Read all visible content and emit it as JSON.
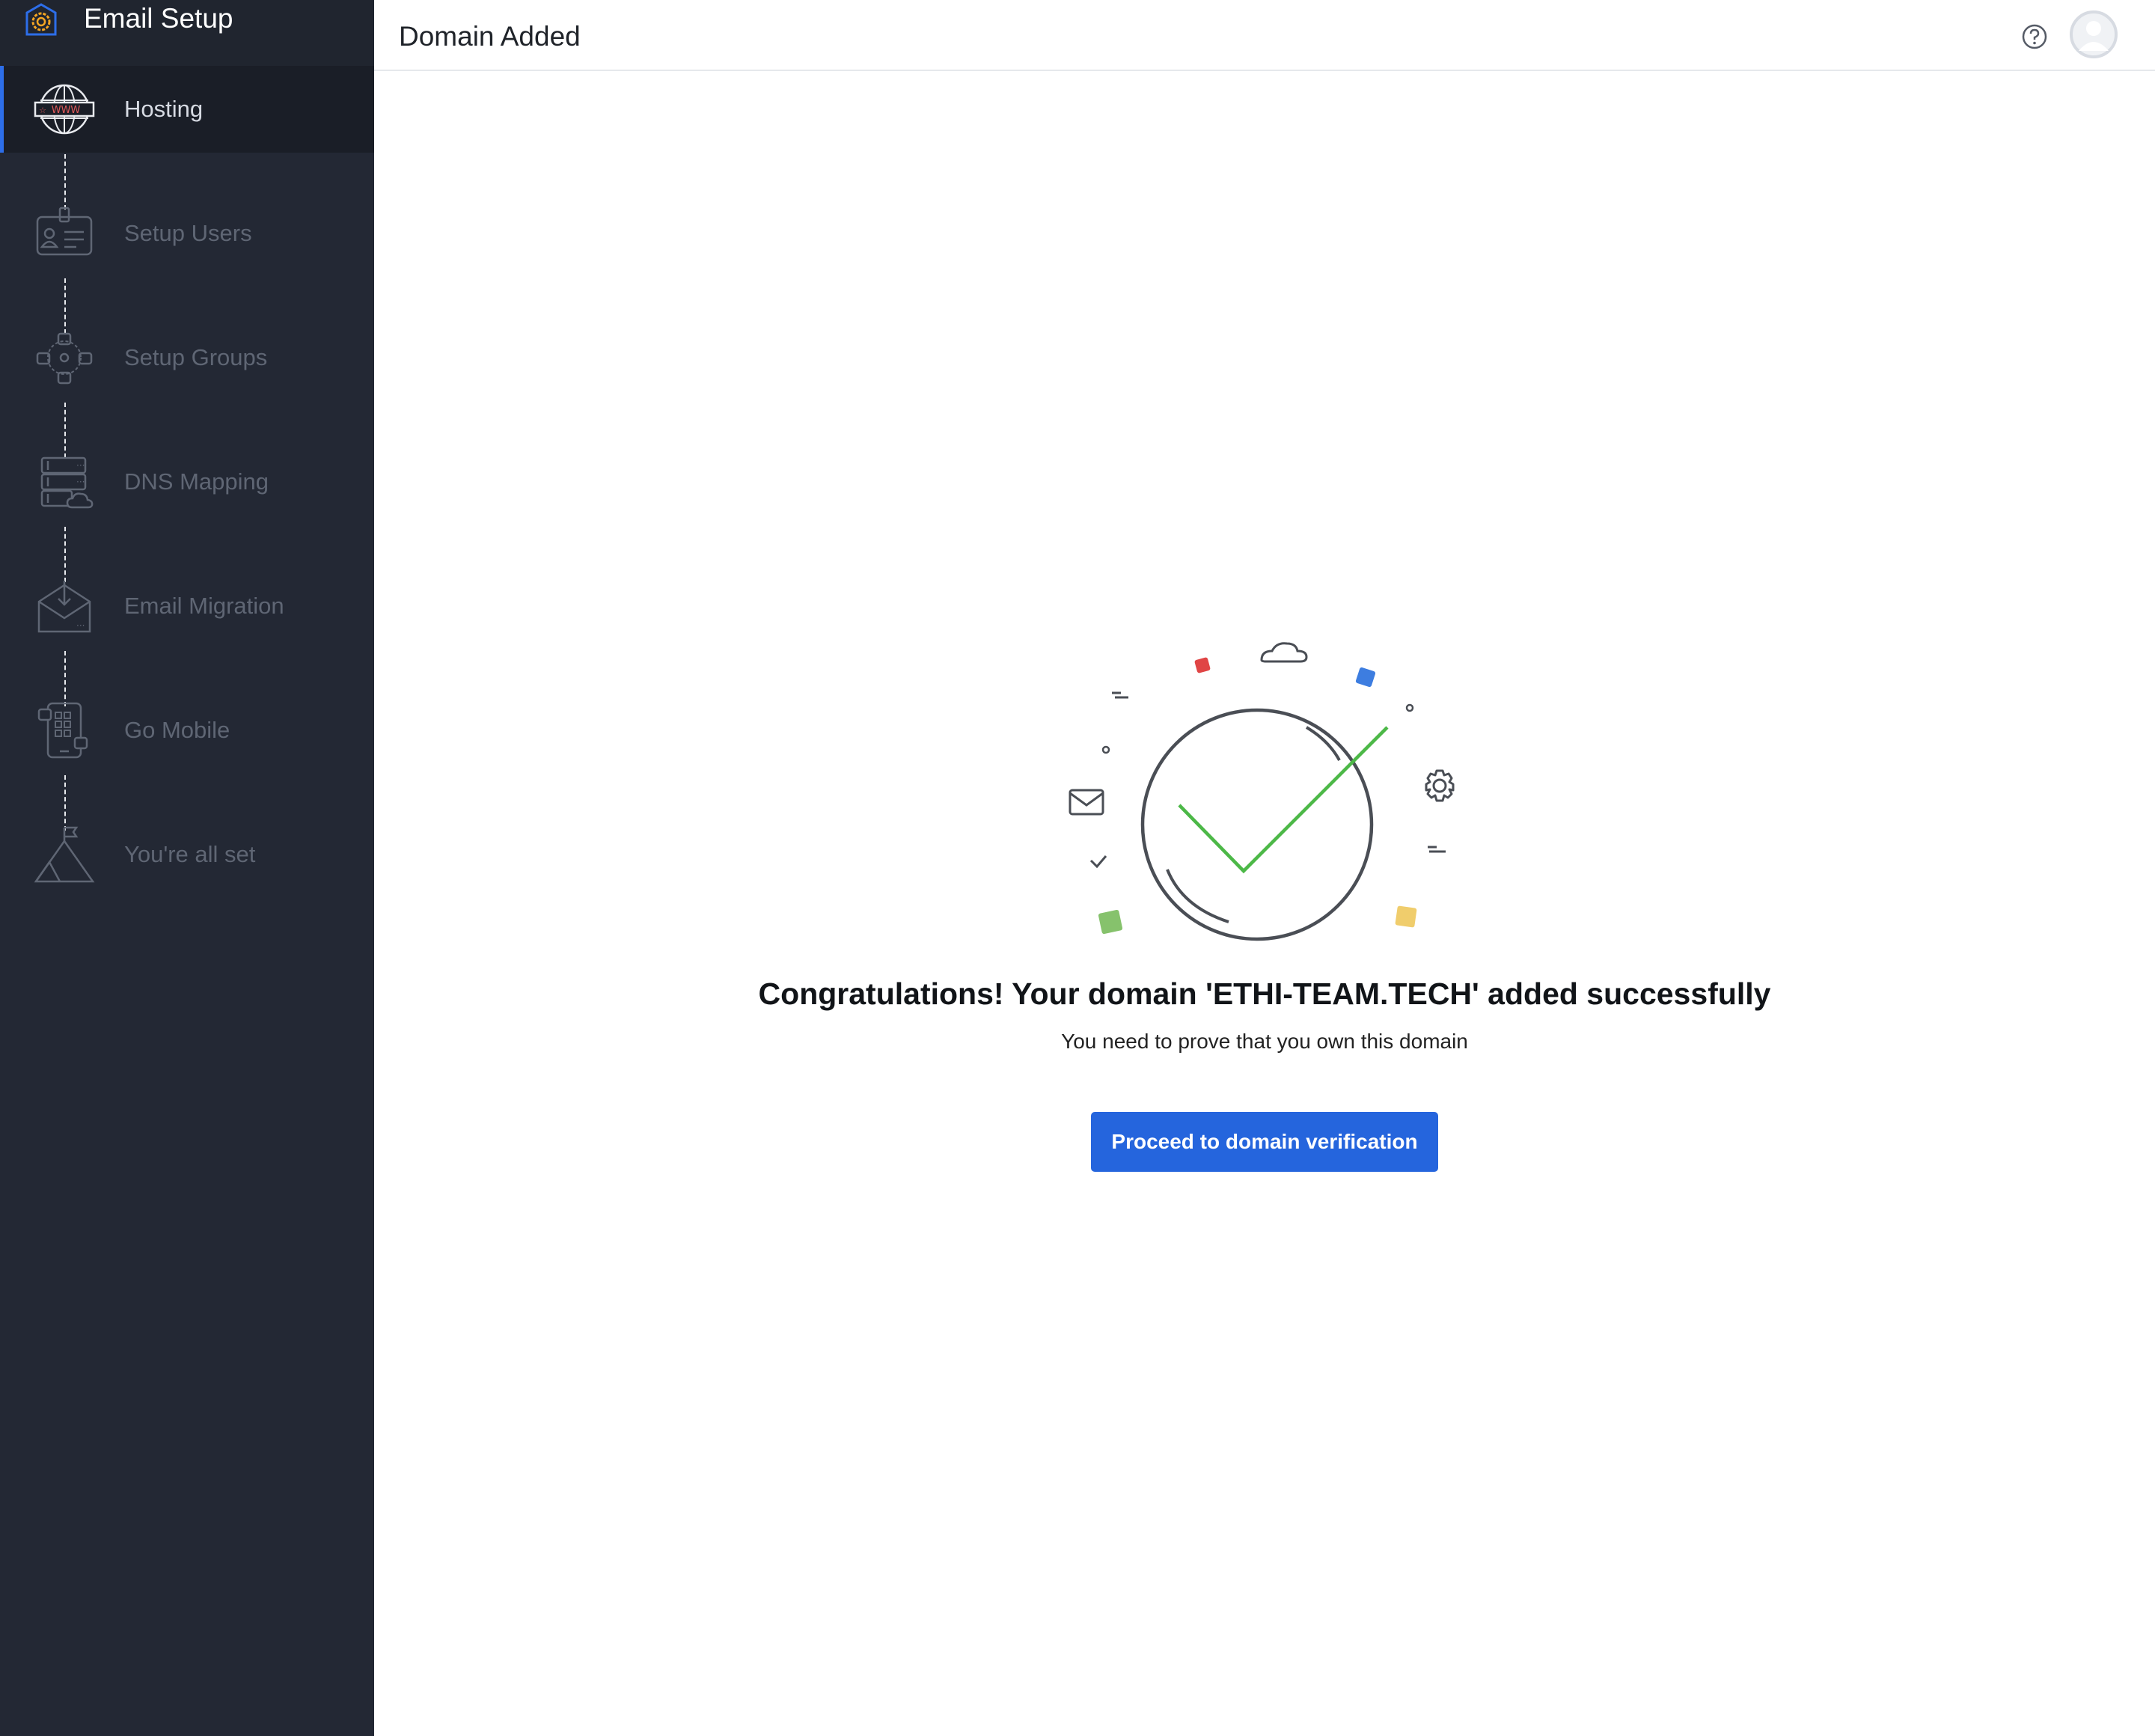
{
  "app": {
    "title": "Email Setup"
  },
  "header": {
    "title": "Domain Added"
  },
  "sidebar": {
    "steps": [
      {
        "label": "Hosting",
        "icon": "globe-www-icon",
        "active": true
      },
      {
        "label": "Setup Users",
        "icon": "id-card-icon",
        "active": false
      },
      {
        "label": "Setup Groups",
        "icon": "group-network-icon",
        "active": false
      },
      {
        "label": "DNS Mapping",
        "icon": "server-cloud-icon",
        "active": false
      },
      {
        "label": "Email Migration",
        "icon": "envelope-download-icon",
        "active": false
      },
      {
        "label": "Go Mobile",
        "icon": "mobile-apps-icon",
        "active": false
      },
      {
        "label": "You're all set",
        "icon": "mountain-flag-icon",
        "active": false
      }
    ]
  },
  "main": {
    "heading": "Congratulations! Your domain 'ETHI-TEAM.TECH' added successfully",
    "subtext": "You need to prove that you own this domain",
    "button_label": "Proceed to domain verification"
  },
  "colors": {
    "sidebar_bg": "#232834",
    "accent": "#2565dd",
    "success": "#4cb847"
  }
}
